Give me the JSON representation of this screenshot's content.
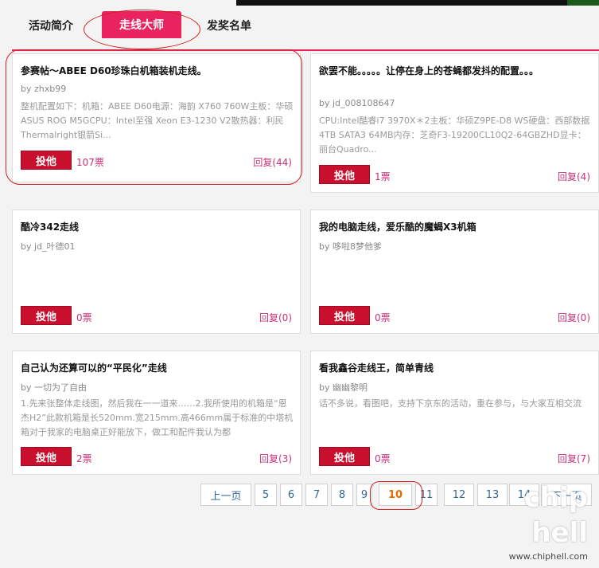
{
  "tabs": {
    "intro": "活动简介",
    "active": "走线大师",
    "winners": "发奖名单"
  },
  "vote_label": "投他",
  "cards": [
    {
      "title": "参赛帖～ABEE D60珍珠白机箱装机走线。",
      "author": "by zhxb99",
      "excerpt": "整机配置如下：机箱：ABEE D60电源：海韵 X760 760W主板：华硕ASUS ROG M5GCPU：Intel至强 Xeon E3-1230 V2散热器：利民Thermalright银箭Si...",
      "votes": "107票",
      "reply": "回复(44)"
    },
    {
      "title": "欲罢不能。。。。。让停在身上的苍蝇都发抖的配置。。。",
      "author": "by jd_008108647",
      "excerpt": "CPU:Intel酷睿i7 3970X＊2主板：华硕Z9PE-D8 WS硬盘：西部数据4TB SATA3 64MB内存：芝奇F3-19200CL10Q2-64GBZHD显卡：丽台Quadro...",
      "votes": "1票",
      "reply": "回复(4)"
    },
    {
      "title": "酷冷342走线",
      "author": "by jd_叶德01",
      "excerpt": "",
      "votes": "0票",
      "reply": "回复(0)"
    },
    {
      "title": "我的电脑走线，爱乐酷的魔蝎X3机箱",
      "author": "by 哆啦8梦他爹",
      "excerpt": "",
      "votes": "0票",
      "reply": "回复(0)"
    },
    {
      "title": "自己认为还算可以的“平民化”走线",
      "author": "by 一切为了自由",
      "excerpt": "1.先来张整体走线图，然后我在一一道来……2.我所使用的机箱是“恩杰H2”此款机箱是长520mm.宽215mm.高466mm属于标准的中塔机箱对于我家的电脑桌正好能放下，做工和配件我认为都",
      "votes": "2票",
      "reply": "回复(3)"
    },
    {
      "title": "看我鑫谷走线王，简单青线",
      "author": "by 幽幽黎明",
      "excerpt": "话不多说，看图吧，支持下京东的活动，重在参与，与大家互相交流",
      "votes": "0票",
      "reply": "回复(7)"
    }
  ],
  "pagination": {
    "prev": "上一页",
    "pages": [
      "5",
      "6",
      "7",
      "8",
      "9",
      "10",
      "11",
      "12",
      "13",
      "14"
    ],
    "current": "10",
    "next": "下一页"
  },
  "watermark": {
    "text": "chip hell",
    "url": "www.chiphell.com"
  }
}
